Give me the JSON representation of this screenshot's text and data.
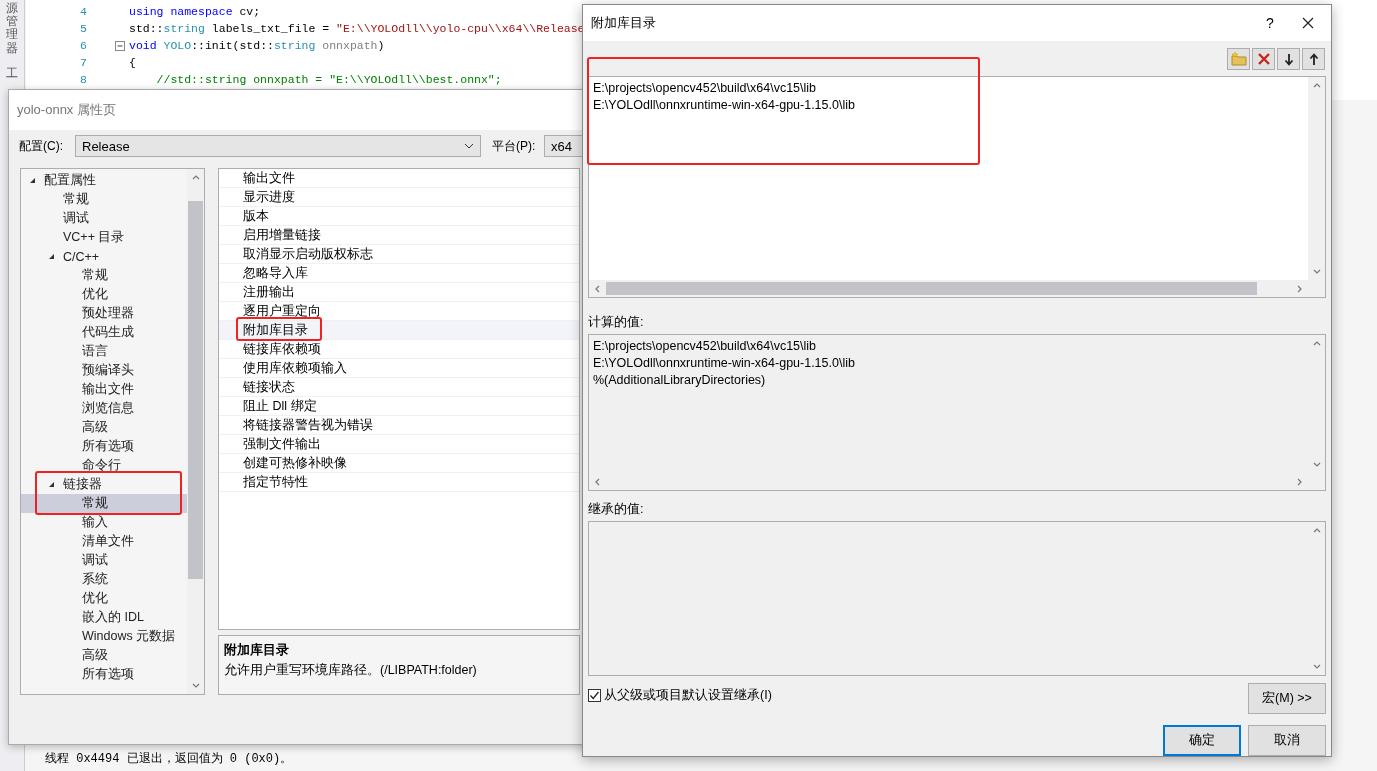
{
  "ide": {
    "side_tabs": [
      "源管理器",
      "工"
    ],
    "code_lines": [
      {
        "number": "4",
        "fold": false,
        "tokens": [
          {
            "text": "using",
            "kind": "keyword"
          },
          {
            "text": " namespace",
            "kind": "keyword"
          },
          {
            "text": " cv;",
            "kind": "plain"
          }
        ]
      },
      {
        "number": "5",
        "fold": false,
        "tokens": [
          {
            "text": "std::",
            "kind": "plain"
          },
          {
            "text": "string",
            "kind": "type"
          },
          {
            "text": " labels_txt_file = ",
            "kind": "plain"
          },
          {
            "text": "\"E:\\\\YOLOdll\\\\yolo-cpu\\\\x64\\\\Release",
            "kind": "string"
          }
        ]
      },
      {
        "number": "6",
        "fold": true,
        "tokens": [
          {
            "text": "void",
            "kind": "keyword"
          },
          {
            "text": " YOLO",
            "kind": "type"
          },
          {
            "text": "::init(std::",
            "kind": "plain"
          },
          {
            "text": "string",
            "kind": "type"
          },
          {
            "text": " onnxpath",
            "kind": "param"
          },
          {
            "text": ")",
            "kind": "plain"
          }
        ]
      },
      {
        "number": "7",
        "fold": false,
        "tokens": [
          {
            "text": "{",
            "kind": "plain"
          }
        ]
      },
      {
        "number": "8",
        "fold": false,
        "tokens": [
          {
            "text": "    //std::string onnxpath = \"E:\\\\YOLOdll\\\\best.onnx\";",
            "kind": "comment"
          }
        ]
      }
    ],
    "output_lines": [
      "线程 0x4494 已退出，返回值为 0 (0x0)。"
    ]
  },
  "property_window": {
    "title": "yolo-onnx 属性页",
    "configuration": {
      "label": "配置(C):",
      "value": "Release"
    },
    "platform": {
      "label": "平台(P):",
      "value": "x64"
    },
    "tree": [
      {
        "label": "配置属性",
        "expanded": true,
        "selected": false,
        "children": [
          {
            "label": "常规",
            "selected": false
          },
          {
            "label": "调试",
            "selected": false
          },
          {
            "label": "VC++ 目录",
            "selected": false
          },
          {
            "label": "C/C++",
            "expanded": true,
            "selected": false,
            "children": [
              {
                "label": "常规",
                "selected": false
              },
              {
                "label": "优化",
                "selected": false
              },
              {
                "label": "预处理器",
                "selected": false
              },
              {
                "label": "代码生成",
                "selected": false
              },
              {
                "label": "语言",
                "selected": false
              },
              {
                "label": "预编译头",
                "selected": false
              },
              {
                "label": "输出文件",
                "selected": false
              },
              {
                "label": "浏览信息",
                "selected": false
              },
              {
                "label": "高级",
                "selected": false
              },
              {
                "label": "所有选项",
                "selected": false
              },
              {
                "label": "命令行",
                "selected": false
              }
            ]
          },
          {
            "label": "链接器",
            "expanded": true,
            "selected": false,
            "children": [
              {
                "label": "常规",
                "selected": true
              },
              {
                "label": "输入",
                "selected": false
              },
              {
                "label": "清单文件",
                "selected": false
              },
              {
                "label": "调试",
                "selected": false
              },
              {
                "label": "系统",
                "selected": false
              },
              {
                "label": "优化",
                "selected": false
              },
              {
                "label": "嵌入的 IDL",
                "selected": false
              },
              {
                "label": "Windows 元数据",
                "selected": false
              },
              {
                "label": "高级",
                "selected": false
              },
              {
                "label": "所有选项",
                "selected": false
              }
            ]
          }
        ]
      }
    ],
    "properties": [
      {
        "label": "输出文件",
        "selected": false
      },
      {
        "label": "显示进度",
        "selected": false
      },
      {
        "label": "版本",
        "selected": false
      },
      {
        "label": "启用增量链接",
        "selected": false
      },
      {
        "label": "取消显示启动版权标志",
        "selected": false
      },
      {
        "label": "忽略导入库",
        "selected": false
      },
      {
        "label": "注册输出",
        "selected": false
      },
      {
        "label": "逐用户重定向",
        "selected": false
      },
      {
        "label": "附加库目录",
        "selected": true
      },
      {
        "label": "链接库依赖项",
        "selected": false
      },
      {
        "label": "使用库依赖项输入",
        "selected": false
      },
      {
        "label": "链接状态",
        "selected": false
      },
      {
        "label": "阻止 Dll 绑定",
        "selected": false
      },
      {
        "label": "将链接器警告视为错误",
        "selected": false
      },
      {
        "label": "强制文件输出",
        "selected": false
      },
      {
        "label": "创建可热修补映像",
        "selected": false
      },
      {
        "label": "指定节特性",
        "selected": false
      }
    ],
    "description": {
      "title": "附加库目录",
      "text": "允许用户重写环境库路径。(/LIBPATH:folder)"
    }
  },
  "dialog": {
    "title": "附加库目录",
    "help": "?",
    "list": [
      "E:\\projects\\opencv452\\build\\x64\\vc15\\lib",
      "E:\\YOLOdll\\onnxruntime-win-x64-gpu-1.15.0\\lib"
    ],
    "computed_label": "计算的值:",
    "computed": [
      "E:\\projects\\opencv452\\build\\x64\\vc15\\lib",
      "E:\\YOLOdll\\onnxruntime-win-x64-gpu-1.15.0\\lib",
      "%(AdditionalLibraryDirectories)"
    ],
    "inherited_label": "继承的值:",
    "inherit": {
      "label": "从父级或项目默认设置继承(I)",
      "checked": true
    },
    "macros_button": "宏(M) >>",
    "buttons": [
      {
        "label": "确定",
        "default": true
      },
      {
        "label": "取消",
        "default": false
      }
    ]
  }
}
